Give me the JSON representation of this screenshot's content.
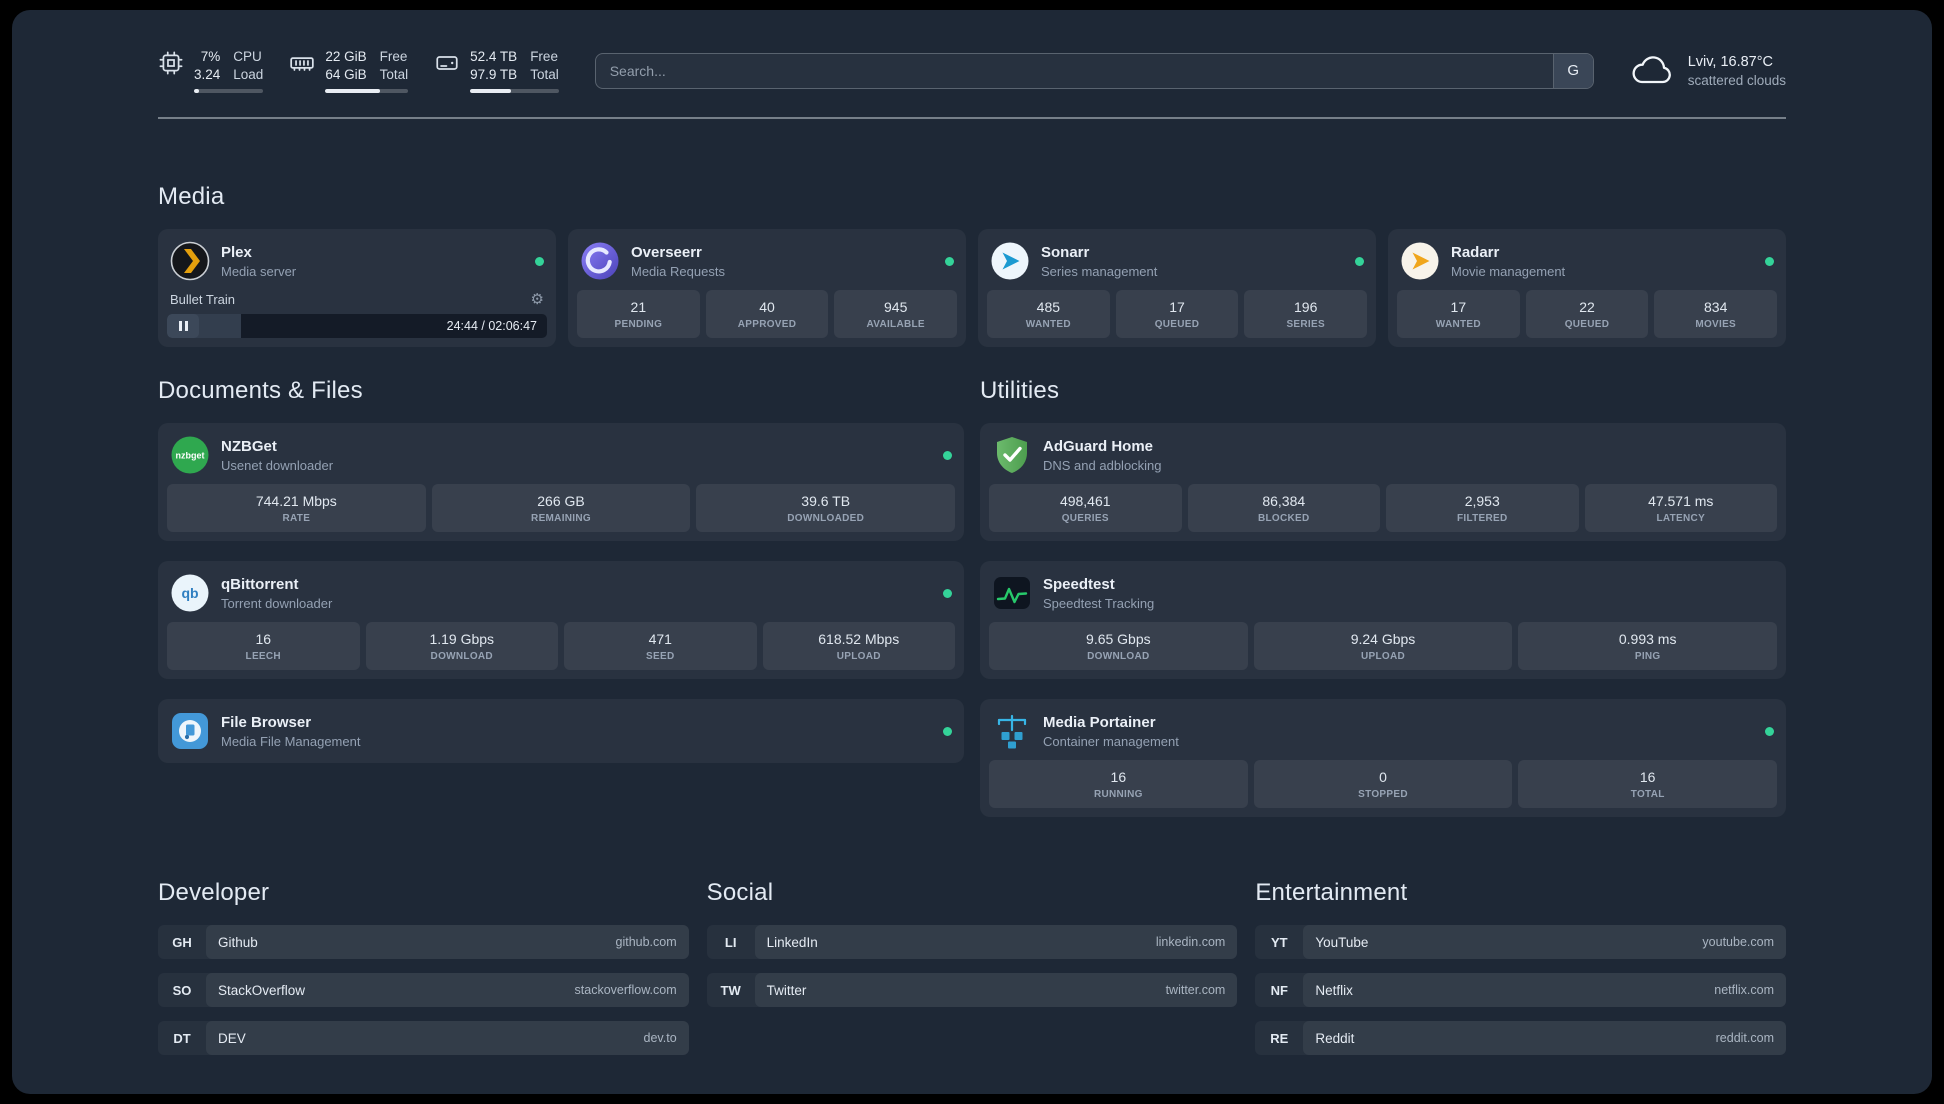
{
  "topbar": {
    "resources": [
      {
        "values": [
          "7%",
          "3.24"
        ],
        "labels": [
          "CPU",
          "Load"
        ],
        "progress": 7
      },
      {
        "values": [
          "22 GiB",
          "64 GiB"
        ],
        "labels": [
          "Free",
          "Total"
        ],
        "progress": 66
      },
      {
        "values": [
          "52.4 TB",
          "97.9 TB"
        ],
        "labels": [
          "Free",
          "Total"
        ],
        "progress": 46
      }
    ],
    "search": {
      "placeholder": "Search...",
      "provider_label": "G"
    },
    "weather": {
      "location": "Lviv, 16.87°C",
      "condition": "scattered clouds"
    }
  },
  "sections": {
    "media": {
      "title": "Media",
      "plex": {
        "name": "Plex",
        "desc": "Media server",
        "player": {
          "track": "Bullet Train",
          "time": "24:44 / 02:06:47",
          "progress": 19.5
        }
      },
      "overseerr": {
        "name": "Overseerr",
        "desc": "Media Requests",
        "stats": [
          {
            "value": "21",
            "label": "PENDING"
          },
          {
            "value": "40",
            "label": "APPROVED"
          },
          {
            "value": "945",
            "label": "AVAILABLE"
          }
        ]
      },
      "sonarr": {
        "name": "Sonarr",
        "desc": "Series management",
        "stats": [
          {
            "value": "485",
            "label": "WANTED"
          },
          {
            "value": "17",
            "label": "QUEUED"
          },
          {
            "value": "196",
            "label": "SERIES"
          }
        ]
      },
      "radarr": {
        "name": "Radarr",
        "desc": "Movie management",
        "stats": [
          {
            "value": "17",
            "label": "WANTED"
          },
          {
            "value": "22",
            "label": "QUEUED"
          },
          {
            "value": "834",
            "label": "MOVIES"
          }
        ]
      }
    },
    "documents": {
      "title": "Documents & Files",
      "nzbget": {
        "name": "NZBGet",
        "desc": "Usenet downloader",
        "stats": [
          {
            "value": "744.21 Mbps",
            "label": "RATE"
          },
          {
            "value": "266 GB",
            "label": "REMAINING"
          },
          {
            "value": "39.6 TB",
            "label": "DOWNLOADED"
          }
        ]
      },
      "qbittorrent": {
        "name": "qBittorrent",
        "desc": "Torrent downloader",
        "stats": [
          {
            "value": "16",
            "label": "LEECH"
          },
          {
            "value": "1.19 Gbps",
            "label": "DOWNLOAD"
          },
          {
            "value": "471",
            "label": "SEED"
          },
          {
            "value": "618.52 Mbps",
            "label": "UPLOAD"
          }
        ]
      },
      "filebrowser": {
        "name": "File Browser",
        "desc": "Media File Management"
      }
    },
    "utilities": {
      "title": "Utilities",
      "adguard": {
        "name": "AdGuard Home",
        "desc": "DNS and adblocking",
        "stats": [
          {
            "value": "498,461",
            "label": "QUERIES"
          },
          {
            "value": "86,384",
            "label": "BLOCKED"
          },
          {
            "value": "2,953",
            "label": "FILTERED"
          },
          {
            "value": "47.571 ms",
            "label": "LATENCY"
          }
        ]
      },
      "speedtest": {
        "name": "Speedtest",
        "desc": "Speedtest Tracking",
        "stats": [
          {
            "value": "9.65 Gbps",
            "label": "DOWNLOAD"
          },
          {
            "value": "9.24 Gbps",
            "label": "UPLOAD"
          },
          {
            "value": "0.993 ms",
            "label": "PING"
          }
        ]
      },
      "portainer": {
        "name": "Media Portainer",
        "desc": "Container management",
        "stats": [
          {
            "value": "16",
            "label": "RUNNING"
          },
          {
            "value": "0",
            "label": "STOPPED"
          },
          {
            "value": "16",
            "label": "TOTAL"
          }
        ]
      }
    },
    "developer": {
      "title": "Developer",
      "links": [
        {
          "abbr": "GH",
          "name": "Github",
          "url": "github.com"
        },
        {
          "abbr": "SO",
          "name": "StackOverflow",
          "url": "stackoverflow.com"
        },
        {
          "abbr": "DT",
          "name": "DEV",
          "url": "dev.to"
        }
      ]
    },
    "social": {
      "title": "Social",
      "links": [
        {
          "abbr": "LI",
          "name": "LinkedIn",
          "url": "linkedin.com"
        },
        {
          "abbr": "TW",
          "name": "Twitter",
          "url": "twitter.com"
        }
      ]
    },
    "entertainment": {
      "title": "Entertainment",
      "links": [
        {
          "abbr": "YT",
          "name": "YouTube",
          "url": "youtube.com"
        },
        {
          "abbr": "NF",
          "name": "Netflix",
          "url": "netflix.com"
        },
        {
          "abbr": "RE",
          "name": "Reddit",
          "url": "reddit.com"
        }
      ]
    }
  },
  "status": {
    "online_color": "#34d399"
  }
}
